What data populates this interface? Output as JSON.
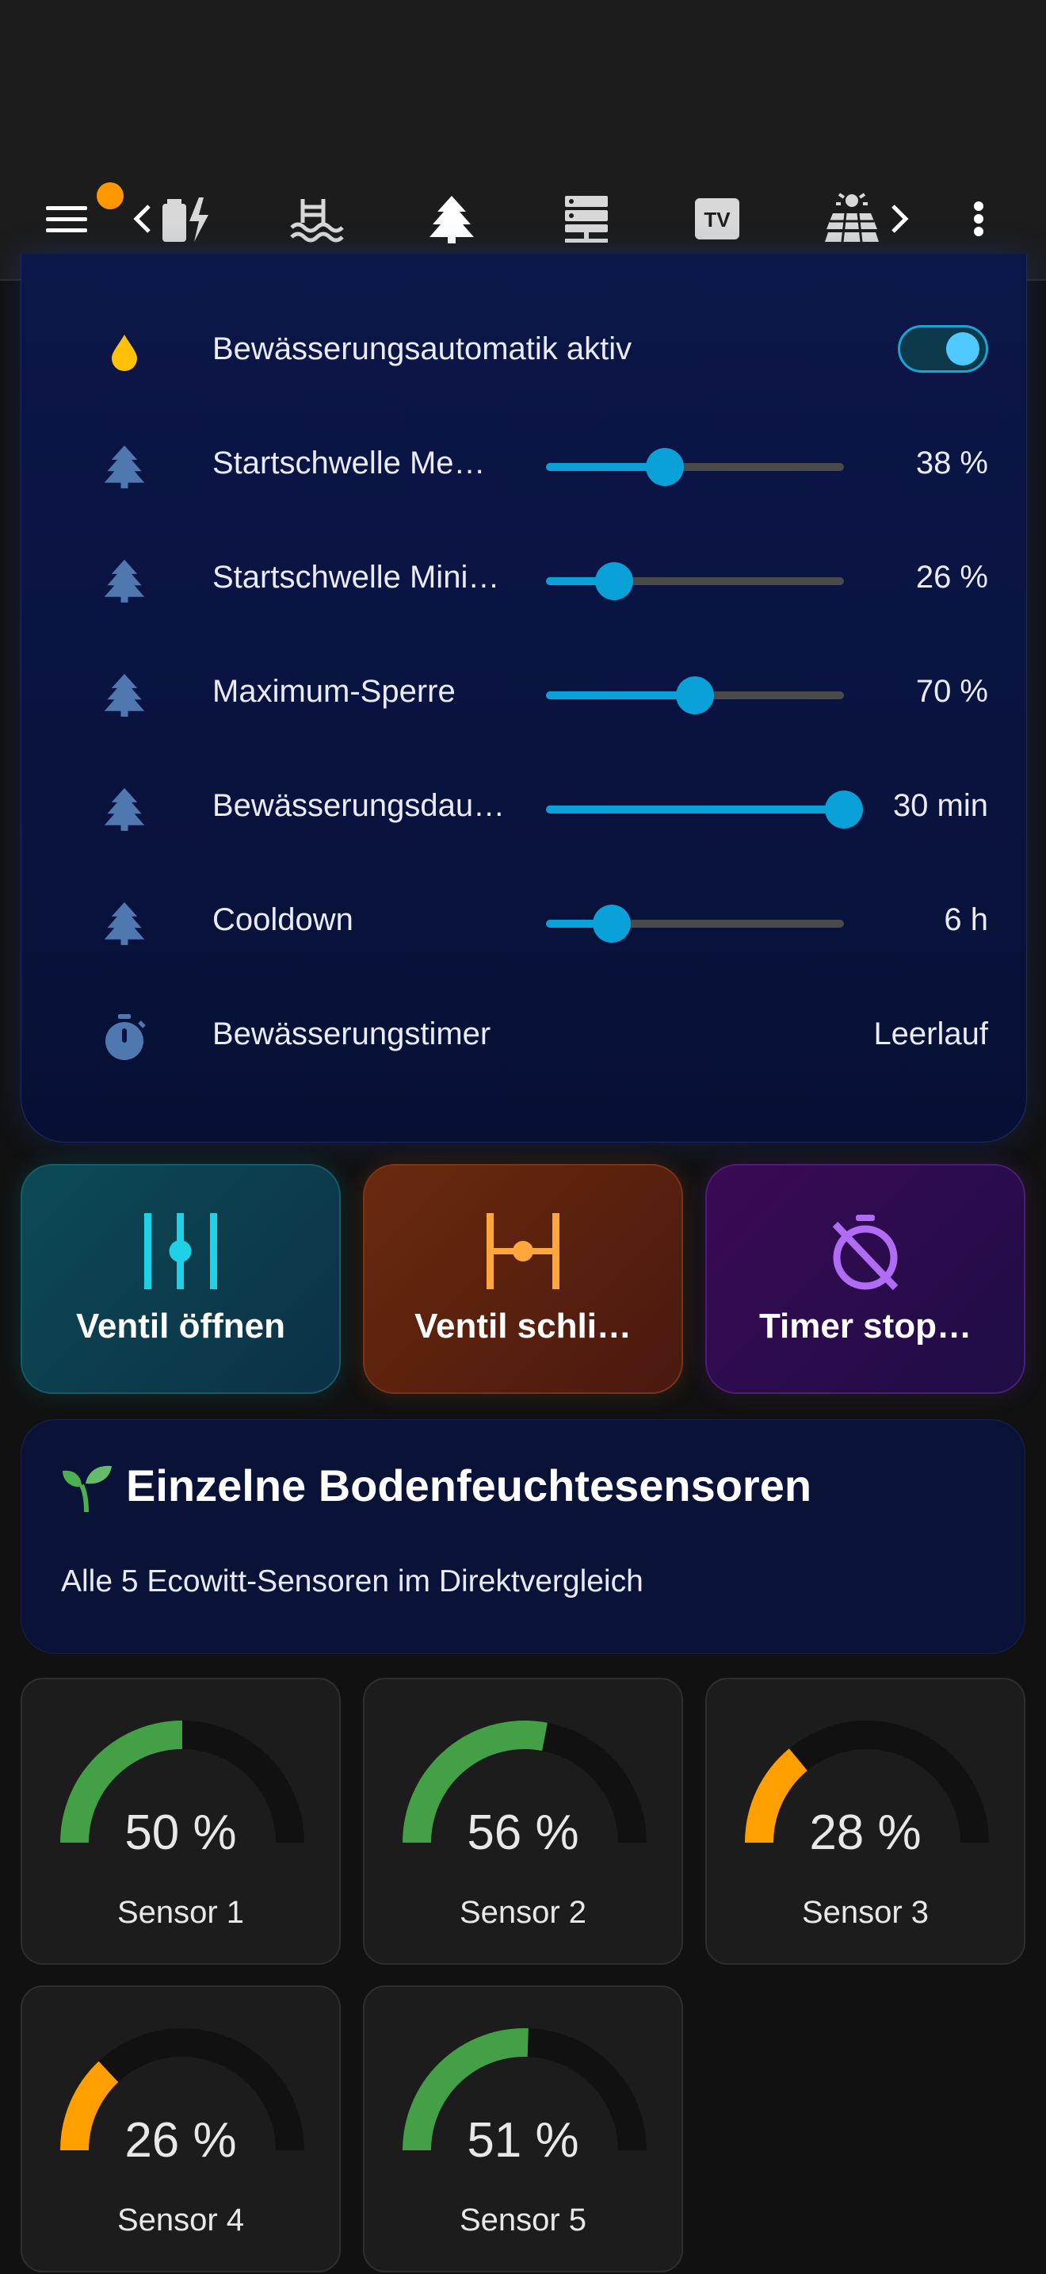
{
  "colors": {
    "accent": "#0aa0d8",
    "gauge_green": "#43a047",
    "gauge_orange": "#ffa000",
    "badge": "#ff9800"
  },
  "toolbar": {
    "icons": [
      "menu-icon",
      "chevron-left-icon",
      "battery-charging-icon",
      "pool-icon",
      "pine-tree-icon",
      "server-icon",
      "tv-icon",
      "solar-panel-icon",
      "chevron-right-icon",
      "more-vertical-icon"
    ],
    "active_tab": "pine-tree-icon",
    "tv_text": "TV"
  },
  "controls": {
    "auto_label": "Bewässerungsautomatik aktiv",
    "auto_on": true,
    "sliders": [
      {
        "label": "Startschwelle Me…",
        "value": "38 %",
        "fraction": 0.4
      },
      {
        "label": "Startschwelle Mini…",
        "value": "26 %",
        "fraction": 0.23
      },
      {
        "label": "Maximum-Sperre",
        "value": "70 %",
        "fraction": 0.5
      },
      {
        "label": "Bewässerungsdau…",
        "value": "30 min",
        "fraction": 1.0
      },
      {
        "label": "Cooldown",
        "value": "6 h",
        "fraction": 0.22
      }
    ],
    "timer_label": "Bewässerungstimer",
    "timer_value": "Leerlauf"
  },
  "buttons": {
    "open": "Ventil öffnen",
    "close": "Ventil schli…",
    "timer_stop": "Timer stop…"
  },
  "sensors_header": {
    "title": "Einzelne Bodenfeuchtesensoren",
    "subtitle": "Alle 5 Ecowitt-Sensoren im Direktvergleich"
  },
  "sensors": [
    {
      "name": "Sensor 1",
      "value": "50 %",
      "pct": 50,
      "color": "#43a047"
    },
    {
      "name": "Sensor 2",
      "value": "56 %",
      "pct": 56,
      "color": "#43a047"
    },
    {
      "name": "Sensor 3",
      "value": "28 %",
      "pct": 28,
      "color": "#ffa000"
    },
    {
      "name": "Sensor 4",
      "value": "26 %",
      "pct": 26,
      "color": "#ffa000"
    },
    {
      "name": "Sensor 5",
      "value": "51 %",
      "pct": 51,
      "color": "#43a047"
    }
  ]
}
